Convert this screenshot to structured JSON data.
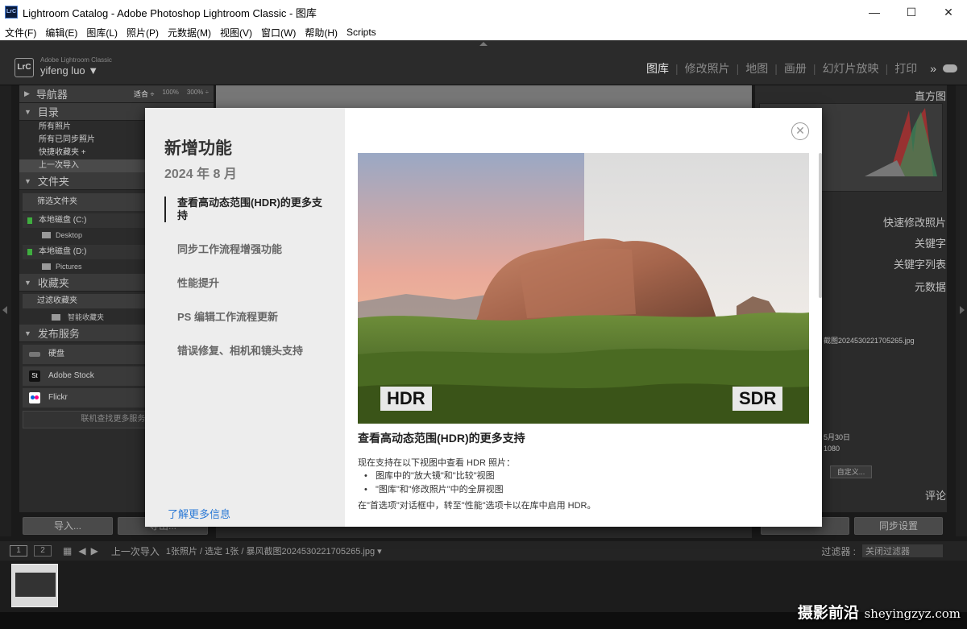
{
  "window": {
    "title": "Lightroom Catalog - Adobe Photoshop Lightroom Classic - 图库",
    "app_icon": "LrC",
    "minimize": "—",
    "maximize": "☐",
    "close": "✕"
  },
  "menu": [
    "文件(F)",
    "编辑(E)",
    "图库(L)",
    "照片(P)",
    "元数据(M)",
    "视图(V)",
    "窗口(W)",
    "帮助(H)",
    "Scripts"
  ],
  "brand": {
    "logo": "LrC",
    "subtitle": "Adobe Lightroom Classic",
    "user": "yifeng luo ▼"
  },
  "modules": [
    "图库",
    "修改照片",
    "地图",
    "画册",
    "幻灯片放映",
    "打印"
  ],
  "modules_more": "»",
  "left_panel": {
    "navigator": "导航器",
    "zoom": [
      "适合 ÷",
      "100%",
      "300% ÷"
    ],
    "catalog": "目录",
    "catalog_items": [
      "所有照片",
      "所有已同步照片",
      "快捷收藏夹 +",
      "上一次导入"
    ],
    "folders": "文件夹",
    "folder_filter": "筛选文件夹",
    "disks": [
      {
        "name": "本地磁盘 (C:)",
        "sub": "Desktop"
      },
      {
        "name": "本地磁盘 (D:)",
        "sub": "Pictures"
      }
    ],
    "collections": "收藏夹",
    "collection_filter": "过滤收藏夹",
    "smart_collection": "智能收藏夹",
    "publish": "发布服务",
    "publish_items": [
      "硬盘",
      "Adobe Stock",
      "Flickr"
    ],
    "publish_more": "联机查找更多服务...",
    "import_btn": "导入...",
    "export_btn": "导出..."
  },
  "right_panel": {
    "histogram": "直方图",
    "quick_develop": "快速修改照片",
    "keywording": "关键字",
    "keyword_list": "关键字列表",
    "metadata": "元数据",
    "filename": "截图2024530221705265.jpg",
    "date": "5月30日",
    "dims": "1080",
    "customize": "自定义...",
    "comments": "评论",
    "sync_meta": "同步设置"
  },
  "filmstrip": {
    "page1": "1",
    "page2": "2",
    "source": "上一次导入",
    "info": "1张照片 / 选定 1张 / 暴风截图2024530221705265.jpg ▾",
    "filter_label": "过滤器 :",
    "filter_value": "关闭过滤器"
  },
  "dialog": {
    "title": "新增功能",
    "date": "2024 年 8 月",
    "nav": [
      "查看高动态范围(HDR)的更多支持",
      "同步工作流程增强功能",
      "性能提升",
      "PS 编辑工作流程更新",
      "错误修复、相机和镜头支持"
    ],
    "learn_more": "了解更多信息",
    "close": "✕",
    "hdr_label": "HDR",
    "sdr_label": "SDR",
    "content_title": "查看高动态范围(HDR)的更多支持",
    "content_intro": "现在支持在以下视图中查看 HDR 照片：",
    "content_bullets": [
      "图库中的\"放大镜\"和\"比较\"视图",
      "\"图库\"和\"修改照片\"中的全屏视图"
    ],
    "content_footer": "在\"首选项\"对话框中，转至\"性能\"选项卡以在库中启用 HDR。"
  },
  "watermark": {
    "text": "摄影前沿",
    "domain": "sheyingzyz.com"
  }
}
